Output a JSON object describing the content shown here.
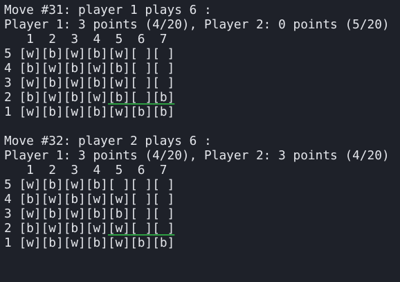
{
  "accent_underline_color": "#2ea043",
  "background_color": "#1e2129",
  "text_color": "#e4e6eb",
  "blocks": [
    {
      "move_line": "Move #31: player 1 plays 6 :",
      "score_line": "Player 1: 3 points (4/20), Player 2: 0 points (5/20)",
      "header": "   1  2  3  4  5  6  7",
      "rows": [
        {
          "label": "5",
          "cells": [
            "[w]",
            "[b]",
            "[w]",
            "[b]",
            "[w]",
            "[ ]",
            "[ ]"
          ],
          "highlight": []
        },
        {
          "label": "4",
          "cells": [
            "[b]",
            "[w]",
            "[b]",
            "[w]",
            "[b]",
            "[ ]",
            "[ ]"
          ],
          "highlight": []
        },
        {
          "label": "3",
          "cells": [
            "[w]",
            "[b]",
            "[w]",
            "[b]",
            "[w]",
            "[ ]",
            "[ ]"
          ],
          "highlight": []
        },
        {
          "label": "2",
          "cells": [
            "[b]",
            "[w]",
            "[b]",
            "[w]",
            "[b]",
            "[ ]",
            "[b]"
          ],
          "highlight": [
            4,
            5,
            6
          ]
        },
        {
          "label": "1",
          "cells": [
            "[w]",
            "[b]",
            "[w]",
            "[b]",
            "[w]",
            "[b]",
            "[b]"
          ],
          "highlight": []
        }
      ]
    },
    {
      "move_line": "Move #32: player 2 plays 6 :",
      "score_line": "Player 1: 3 points (4/20), Player 2: 3 points (4/20)",
      "header": "   1  2  3  4  5  6  7",
      "rows": [
        {
          "label": "5",
          "cells": [
            "[w]",
            "[b]",
            "[w]",
            "[b]",
            "[ ]",
            "[ ]",
            "[ ]"
          ],
          "highlight": []
        },
        {
          "label": "4",
          "cells": [
            "[b]",
            "[w]",
            "[b]",
            "[w]",
            "[w]",
            "[ ]",
            "[ ]"
          ],
          "highlight": []
        },
        {
          "label": "3",
          "cells": [
            "[w]",
            "[b]",
            "[w]",
            "[b]",
            "[b]",
            "[ ]",
            "[ ]"
          ],
          "highlight": []
        },
        {
          "label": "2",
          "cells": [
            "[b]",
            "[w]",
            "[b]",
            "[w]",
            "[w]",
            "[ ]",
            "[ ]"
          ],
          "highlight": [
            4,
            5,
            6
          ]
        },
        {
          "label": "1",
          "cells": [
            "[w]",
            "[b]",
            "[w]",
            "[b]",
            "[w]",
            "[b]",
            "[b]"
          ],
          "highlight": []
        }
      ]
    }
  ]
}
